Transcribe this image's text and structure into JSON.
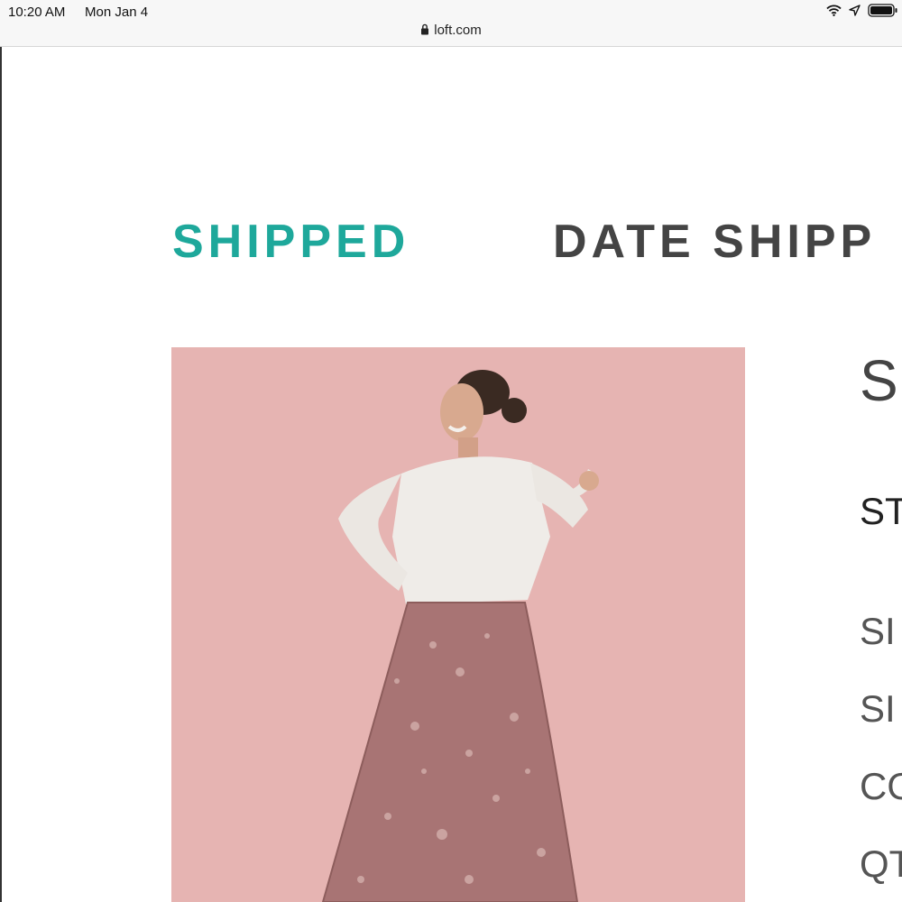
{
  "status_bar": {
    "time": "10:20 AM",
    "date": "Mon Jan 4",
    "url": "loft.com"
  },
  "tabs": {
    "shipped": "SHIPPED",
    "date_shipped": "DATE SHIPP"
  },
  "product": {
    "image_icon": "product-photo",
    "title_partial": "S",
    "style_partial": "ST",
    "size_label_1": "SI",
    "size_label_2": "SI",
    "color_label": "CO",
    "qty_label": "QT"
  },
  "colors": {
    "accent": "#1ea89b",
    "heading": "#444444",
    "image_bg": "#e5b2b0"
  }
}
